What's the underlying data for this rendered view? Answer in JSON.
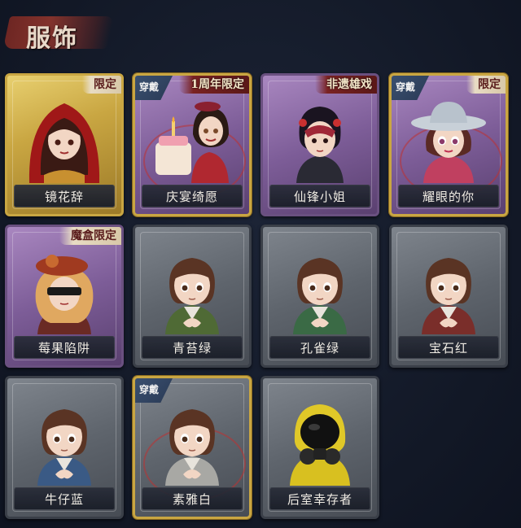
{
  "section": {
    "title": "服饰"
  },
  "costumes": [
    {
      "name": "镜花辞",
      "tag": "限定",
      "tag_style": "light",
      "worn": "",
      "rarity": "gold",
      "portrait": "red-hood"
    },
    {
      "name": "庆宴绮愿",
      "tag": "1周年限定",
      "tag_style": "dark",
      "worn": "穿戴",
      "rarity": "purple",
      "portrait": "party-girl"
    },
    {
      "name": "仙锋小姐",
      "tag": "非遗雄戏",
      "tag_style": "dark",
      "worn": "",
      "rarity": "purple",
      "portrait": "opera-mask"
    },
    {
      "name": "耀眼的你",
      "tag": "限定",
      "tag_style": "light",
      "worn": "穿戴",
      "rarity": "purple",
      "portrait": "cowgirl"
    },
    {
      "name": "莓果陷阱",
      "tag": "魔盒限定",
      "tag_style": "light",
      "worn": "",
      "rarity": "purple",
      "portrait": "blindfold-girl"
    },
    {
      "name": "青苔绿",
      "tag": "",
      "tag_style": "",
      "worn": "",
      "rarity": "grey",
      "portrait": "survivor-green",
      "accent": "#4f6a35"
    },
    {
      "name": "孔雀绿",
      "tag": "",
      "tag_style": "",
      "worn": "",
      "rarity": "grey",
      "portrait": "survivor-teal",
      "accent": "#3a6a45"
    },
    {
      "name": "宝石红",
      "tag": "",
      "tag_style": "",
      "worn": "",
      "rarity": "grey",
      "portrait": "survivor-red",
      "accent": "#7a2e2a"
    },
    {
      "name": "牛仔蓝",
      "tag": "",
      "tag_style": "",
      "worn": "",
      "rarity": "grey",
      "portrait": "survivor-blue",
      "accent": "#3a5a85"
    },
    {
      "name": "素雅白",
      "tag": "",
      "tag_style": "",
      "worn": "穿戴",
      "rarity": "grey",
      "portrait": "survivor-white",
      "accent": "#a8a8a4"
    },
    {
      "name": "后室幸存者",
      "tag": "",
      "tag_style": "",
      "worn": "",
      "rarity": "grey",
      "portrait": "hazmat-survivor",
      "accent": "#d8c020"
    }
  ]
}
